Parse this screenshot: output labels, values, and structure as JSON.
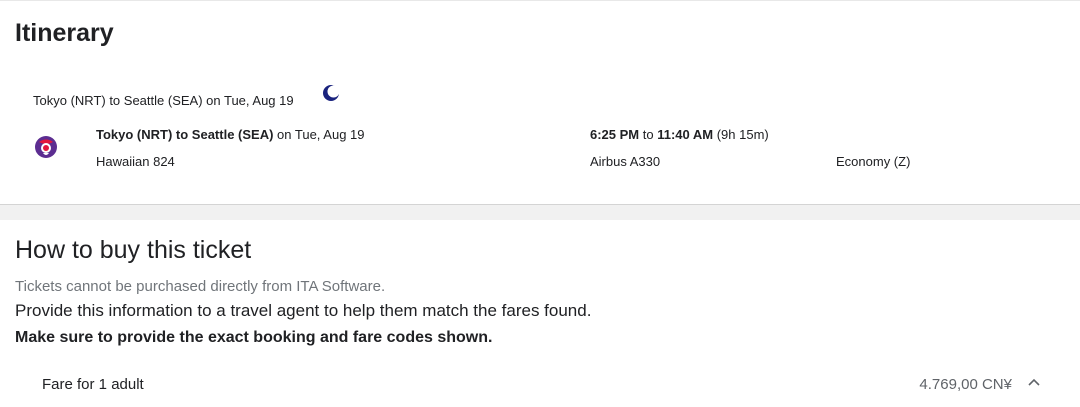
{
  "itinerary": {
    "title": "Itinerary",
    "leg_header": "Tokyo (NRT) to Seattle (SEA) on Tue, Aug 19",
    "overnight_icon": "moon-icon",
    "segment": {
      "route": "Tokyo (NRT) to Seattle (SEA)",
      "date_text": " on Tue, Aug 19",
      "depart": "6:25 PM",
      "times_connector": " to ",
      "arrive": "11:40 AM",
      "duration": " (9h 15m)",
      "flight": "Hawaiian 824",
      "aircraft": "Airbus A330",
      "cabin": "Economy (Z)",
      "airline_logo": "hawaiian-airlines-logo"
    }
  },
  "buy": {
    "title": "How to buy this ticket",
    "note": "Tickets cannot be purchased directly from ITA Software.",
    "instruction": "Provide this information to a travel agent to help them match the fares found.",
    "emphasis": "Make sure to provide the exact booking and fare codes shown.",
    "fare": {
      "label": "Fare for 1 adult",
      "price": "4.769,00 CN¥",
      "toggle_icon": "chevron-up-icon"
    }
  },
  "colors": {
    "text": "#202124",
    "muted": "#70757a",
    "moon": "#1a237e",
    "logo_purple": "#5c2d91",
    "logo_red": "#e3173e"
  }
}
